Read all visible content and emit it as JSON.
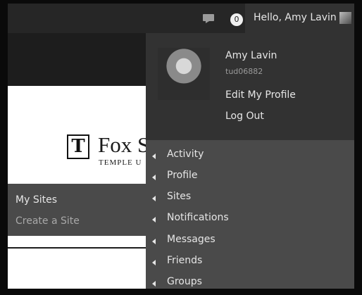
{
  "admin_bar": {
    "notification_count": "0",
    "greeting": "Hello, Amy Lavin"
  },
  "account_menu": {
    "name": "Amy Lavin",
    "username": "tud06882",
    "edit_profile": "Edit My Profile",
    "logout": "Log Out"
  },
  "profile_menu": {
    "items": [
      "Activity",
      "Profile",
      "Sites",
      "Notifications",
      "Messages",
      "Friends",
      "Groups"
    ]
  },
  "site": {
    "logo_title": "Fox S",
    "logo_subtitle": "TEMPLE U"
  },
  "my_sites_menu": {
    "my_sites": "My Sites",
    "create_site": "Create a Site"
  }
}
